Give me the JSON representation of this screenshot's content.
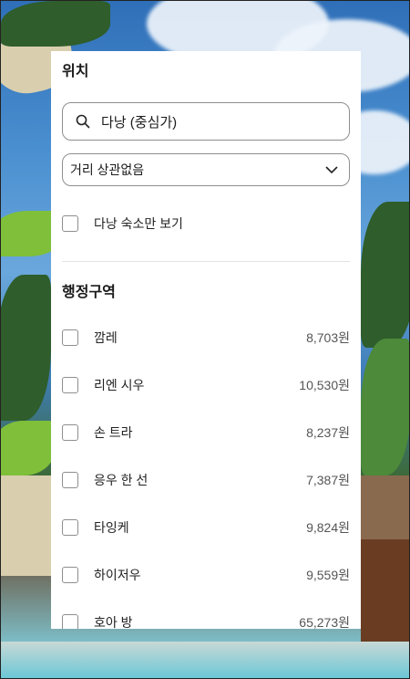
{
  "location": {
    "heading": "위치",
    "search_value": "다낭 (중심가)",
    "distance_selected": "거리 상관없음",
    "only_city_label": "다낭 숙소만 보기"
  },
  "districts": {
    "heading": "행정구역",
    "items": [
      {
        "label": "깜레",
        "count": "8,703원"
      },
      {
        "label": "리엔 시우",
        "count": "10,530원"
      },
      {
        "label": "손 트라",
        "count": "8,237원"
      },
      {
        "label": "응우 한 선",
        "count": "7,387원"
      },
      {
        "label": "타잉케",
        "count": "9,824원"
      },
      {
        "label": "하이저우",
        "count": "9,559원"
      },
      {
        "label": "호아 방",
        "count": "65,273원"
      }
    ]
  }
}
